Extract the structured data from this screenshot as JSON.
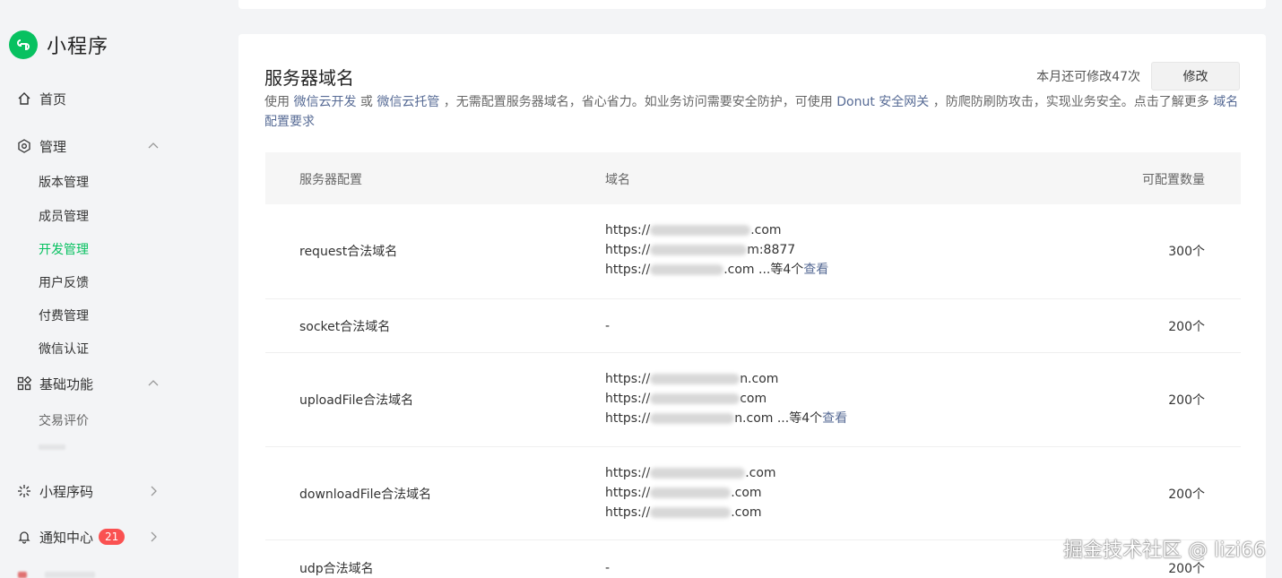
{
  "brand": {
    "title": "小程序",
    "logo_icon": "mini-program-logo-icon",
    "color": "#07c160"
  },
  "sidebar": {
    "home": "首页",
    "manage": "管理",
    "manage_items": [
      "版本管理",
      "成员管理",
      "开发管理",
      "用户反馈",
      "付费管理",
      "微信认证"
    ],
    "basic": "基础功能",
    "basic_items": [
      "交易评价"
    ],
    "qrcode": "小程序码",
    "notify": "通知中心",
    "notify_badge": "21"
  },
  "main": {
    "title": "服务器域名",
    "remain": "本月还可修改47次",
    "edit_label": "修改",
    "desc": {
      "p1": "使用 ",
      "l1": "微信云开发",
      "p2": " 或 ",
      "l2": "微信云托管",
      "p3": " ，无需配置服务器域名，省心省力。如业务访问需要安全防护，可使用 ",
      "l3": "Donut 安全网关",
      "p4": " ，防爬防刷防攻击，实现业务安全。点击了解更多 ",
      "l4": "域名配置要求"
    },
    "columns": {
      "config": "服务器配置",
      "domain": "域名",
      "count": "可配置数量"
    },
    "rows": [
      {
        "name": "request合法域名",
        "count": "300个",
        "domains": [
          {
            "prefix": "https://",
            "suffix": ".com"
          },
          {
            "prefix": "https://",
            "suffix": "m:8877"
          },
          {
            "prefix": "https://",
            "suffix": ".com ...等4个",
            "link": "查看"
          }
        ]
      },
      {
        "name": "socket合法域名",
        "count": "200个",
        "empty": "-"
      },
      {
        "name": "uploadFile合法域名",
        "count": "200个",
        "domains": [
          {
            "prefix": "https://",
            "suffix": "n.com"
          },
          {
            "prefix": "https://",
            "suffix": "com"
          },
          {
            "prefix": "https://",
            "suffix": "n.com ...等4个",
            "link": "查看"
          }
        ]
      },
      {
        "name": "downloadFile合法域名",
        "count": "200个",
        "domains": [
          {
            "prefix": "https://",
            "suffix": ".com"
          },
          {
            "prefix": "https://",
            "suffix": ".com"
          },
          {
            "prefix": "https://",
            "suffix": ".com"
          }
        ]
      },
      {
        "name": "udp合法域名",
        "count": "200个",
        "empty": "-"
      }
    ]
  },
  "watermark": "掘金技术社区 @ lizi66"
}
